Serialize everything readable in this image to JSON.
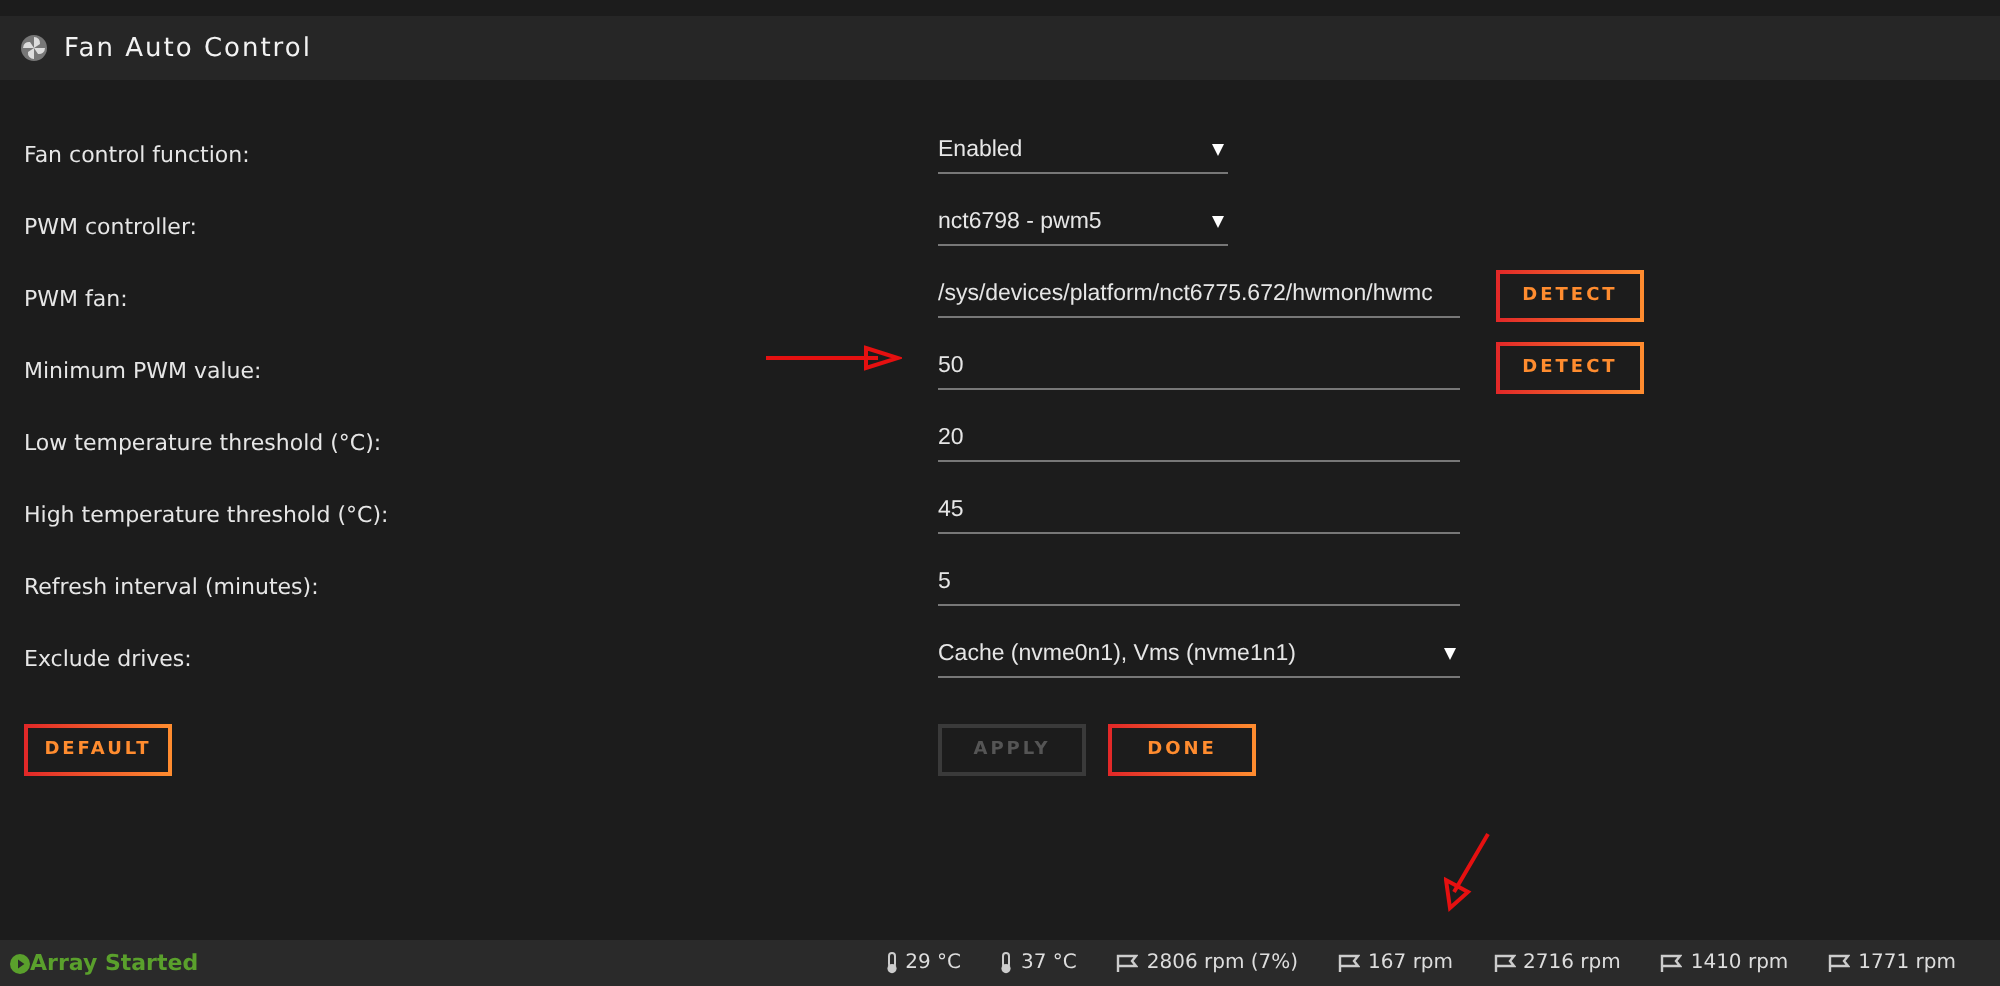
{
  "header": {
    "title": "Fan Auto Control"
  },
  "settings": [
    {
      "label": "Fan control function:",
      "kind": "select",
      "value": "Enabled"
    },
    {
      "label": "PWM controller:",
      "kind": "select",
      "value": "nct6798 - pwm5"
    },
    {
      "label": "PWM fan:",
      "kind": "text",
      "value": "/sys/devices/platform/nct6775.672/hwmon/hwmc",
      "button": "DETECT"
    },
    {
      "label": "Minimum PWM value:",
      "kind": "text",
      "value": "50",
      "button": "DETECT"
    },
    {
      "label": "Low temperature threshold (°C):",
      "kind": "text",
      "value": "20"
    },
    {
      "label": "High temperature threshold (°C):",
      "kind": "text",
      "value": "45"
    },
    {
      "label": "Refresh interval (minutes):",
      "kind": "text",
      "value": "5"
    },
    {
      "label": "Exclude drives:",
      "kind": "multiselect",
      "value": "Cache (nvme0n1), Vms (nvme1n1)"
    }
  ],
  "buttons": {
    "default": {
      "label": "DEFAULT",
      "disabled": false
    },
    "apply": {
      "label": "APPLY",
      "disabled": true
    },
    "done": {
      "label": "DONE",
      "disabled": false
    }
  },
  "status_bar": {
    "array": "Array Started",
    "items": [
      {
        "kind": "temp",
        "text": "29 °C"
      },
      {
        "kind": "temp",
        "text": "37 °C"
      },
      {
        "kind": "fan",
        "text": "2806 rpm (7%)"
      },
      {
        "kind": "fan",
        "text": "167 rpm"
      },
      {
        "kind": "fan",
        "text": "2716 rpm"
      },
      {
        "kind": "fan",
        "text": "1410 rpm"
      },
      {
        "kind": "fan",
        "text": "1771 rpm"
      }
    ]
  }
}
